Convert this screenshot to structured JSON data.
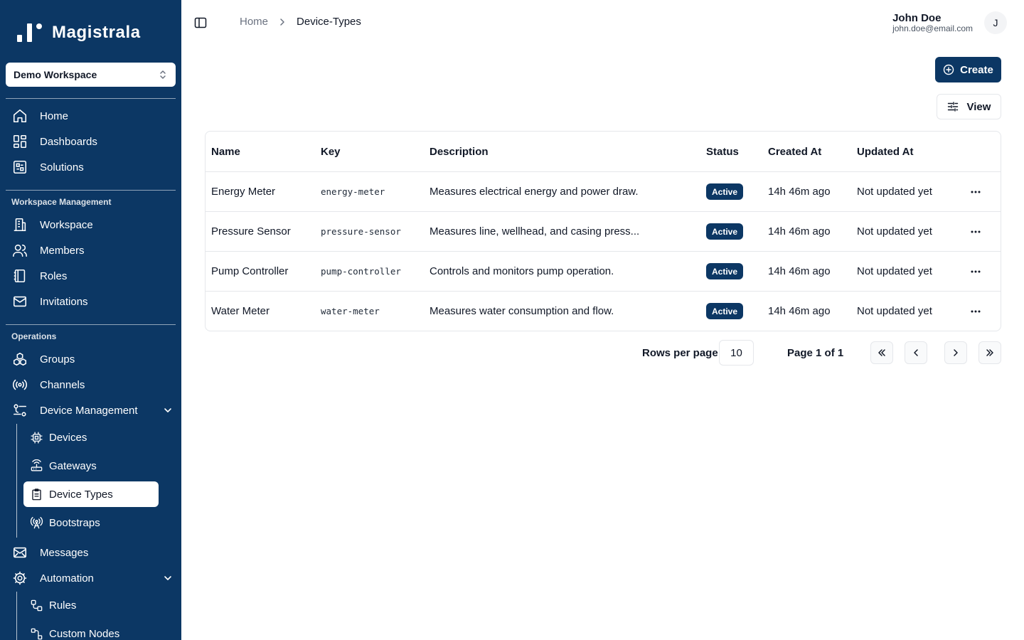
{
  "app": {
    "name": "Magistrala"
  },
  "sidebar": {
    "workspace_selector": "Demo Workspace",
    "top_items": [
      {
        "label": "Home",
        "icon": "home-icon"
      },
      {
        "label": "Dashboards",
        "icon": "dashboard-icon"
      },
      {
        "label": "Solutions",
        "icon": "solutions-icon"
      }
    ],
    "workspace_section": {
      "title": "Workspace Management",
      "items": [
        {
          "label": "Workspace",
          "icon": "building-icon"
        },
        {
          "label": "Members",
          "icon": "users-icon"
        },
        {
          "label": "Roles",
          "icon": "notebook-icon"
        },
        {
          "label": "Invitations",
          "icon": "mail-icon"
        }
      ]
    },
    "operations_section": {
      "title": "Operations",
      "items": [
        {
          "label": "Groups",
          "icon": "groups-icon"
        },
        {
          "label": "Channels",
          "icon": "radio-icon"
        },
        {
          "label": "Device Management",
          "icon": "settings-sliders-icon"
        }
      ],
      "device_management_children": [
        {
          "label": "Devices",
          "icon": "chip-icon"
        },
        {
          "label": "Gateways",
          "icon": "router-icon"
        },
        {
          "label": "Device Types",
          "icon": "clipboard-icon"
        },
        {
          "label": "Bootstraps",
          "icon": "antenna-icon"
        }
      ],
      "messages": {
        "label": "Messages",
        "icon": "mail-open-icon"
      },
      "automation": {
        "label": "Automation",
        "icon": "cog-icon"
      },
      "automation_children": [
        {
          "label": "Rules",
          "icon": "workflow-icon"
        },
        {
          "label": "Custom Nodes",
          "icon": "nodes-icon"
        }
      ]
    }
  },
  "header": {
    "breadcrumb": {
      "home": "Home",
      "current": "Device-Types"
    },
    "user": {
      "name": "John Doe",
      "email": "john.doe@email.com",
      "initial": "J"
    }
  },
  "toolbar": {
    "create_label": "Create",
    "view_label": "View"
  },
  "table": {
    "columns": [
      "Name",
      "Key",
      "Description",
      "Status",
      "Created At",
      "Updated At"
    ],
    "rows": [
      {
        "name": "Energy Meter",
        "key": "energy-meter",
        "description": "Measures electrical energy and power draw.",
        "status": "Active",
        "created": "14h 46m ago",
        "updated": "Not updated yet"
      },
      {
        "name": "Pressure Sensor",
        "key": "pressure-sensor",
        "description": "Measures line, wellhead, and casing press...",
        "status": "Active",
        "created": "14h 46m ago",
        "updated": "Not updated yet"
      },
      {
        "name": "Pump Controller",
        "key": "pump-controller",
        "description": "Controls and monitors pump operation.",
        "status": "Active",
        "created": "14h 46m ago",
        "updated": "Not updated yet"
      },
      {
        "name": "Water Meter",
        "key": "water-meter",
        "description": "Measures water consumption and flow.",
        "status": "Active",
        "created": "14h 46m ago",
        "updated": "Not updated yet"
      }
    ]
  },
  "pagination": {
    "rows_per_page_label": "Rows per page",
    "rows_per_page": "10",
    "page_label": "Page 1 of 1"
  },
  "colors": {
    "primary": "#0c3764",
    "border": "#e5e7eb",
    "text": "#111827",
    "muted": "#6b7280"
  }
}
